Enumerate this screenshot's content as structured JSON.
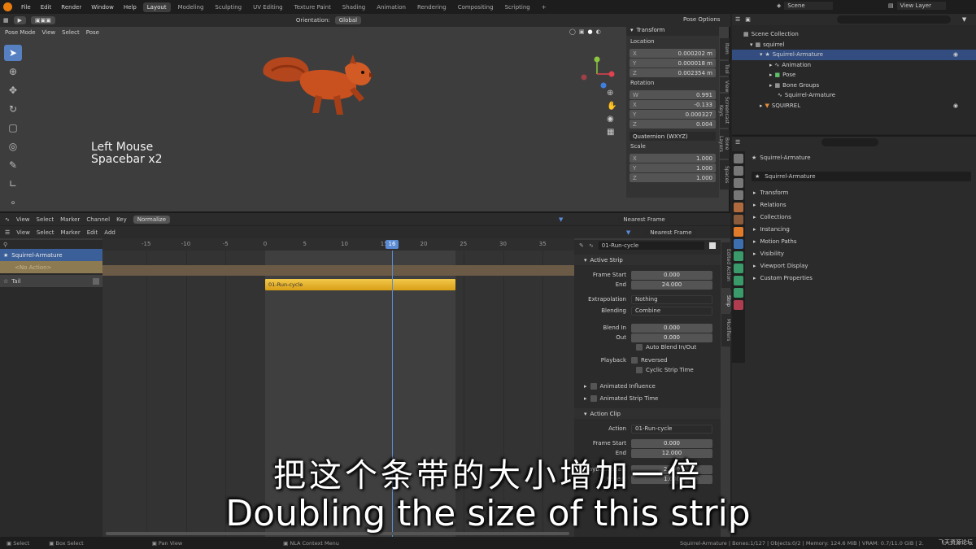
{
  "topbar": {
    "menus": [
      "File",
      "Edit",
      "Render",
      "Window",
      "Help"
    ],
    "workspaces": [
      {
        "label": "Layout",
        "active": true
      },
      {
        "label": "Modeling",
        "active": false
      },
      {
        "label": "Sculpting",
        "active": false
      },
      {
        "label": "UV Editing",
        "active": false
      },
      {
        "label": "Texture Paint",
        "active": false
      },
      {
        "label": "Shading",
        "active": false
      },
      {
        "label": "Animation",
        "active": false
      },
      {
        "label": "Rendering",
        "active": false
      },
      {
        "label": "Compositing",
        "active": false
      },
      {
        "label": "Scripting",
        "active": false
      }
    ],
    "add_workspace": "+",
    "scene": "Scene",
    "view_layer": "View Layer"
  },
  "viewport": {
    "orientation_label": "Orientation:",
    "orientation": "Global",
    "pose_options": "Pose Options",
    "mode": "Pose Mode",
    "menus": [
      "View",
      "Select",
      "Pose"
    ],
    "overlay_line1": "Left Mouse",
    "overlay_line2": "Spacebar x2"
  },
  "npanel": {
    "header": "Transform",
    "location_label": "Location",
    "location": [
      {
        "axis": "X",
        "value": "0.000202 m"
      },
      {
        "axis": "Y",
        "value": "0.000018 m"
      },
      {
        "axis": "Z",
        "value": "0.002354 m"
      }
    ],
    "rotation_label": "Rotation",
    "rotation": [
      {
        "axis": "W",
        "value": "0.991"
      },
      {
        "axis": "X",
        "value": "-0.133"
      },
      {
        "axis": "Y",
        "value": "0.000327"
      },
      {
        "axis": "Z",
        "value": "0.004"
      }
    ],
    "rotation_mode": "Quaternion (WXYZ)",
    "scale_label": "Scale",
    "scale": [
      {
        "axis": "X",
        "value": "1.000"
      },
      {
        "axis": "Y",
        "value": "1.000"
      },
      {
        "axis": "Z",
        "value": "1.000"
      }
    ],
    "tabs": [
      "Item",
      "Tool",
      "View",
      "Screencast Keys",
      "Bone Layers",
      "Spaces"
    ]
  },
  "outliner": {
    "rows": [
      {
        "label": "Scene Collection",
        "indent": 0,
        "selected": false
      },
      {
        "label": "squirrel",
        "indent": 1,
        "selected": false
      },
      {
        "label": "Squirrel-Armature",
        "indent": 2,
        "selected": true
      },
      {
        "label": "Animation",
        "indent": 3,
        "selected": false
      },
      {
        "label": "Pose",
        "indent": 3,
        "selected": false
      },
      {
        "label": "Bone Groups",
        "indent": 3,
        "selected": false
      },
      {
        "label": "Squirrel-Armature",
        "indent": 3,
        "selected": false
      },
      {
        "label": "SQUIRREL",
        "indent": 2,
        "selected": false
      }
    ]
  },
  "properties": {
    "object_name": "Squirrel-Armature",
    "data_name": "Squirrel-Armature",
    "sections": [
      "Transform",
      "Relations",
      "Collections",
      "Instancing",
      "Motion Paths",
      "Visibility",
      "Viewport Display",
      "Custom Properties"
    ]
  },
  "timeline": {
    "menus": [
      "View",
      "Select",
      "Marker",
      "Channel",
      "Key"
    ],
    "mode": "Normalize",
    "snap": "Nearest Frame"
  },
  "nla": {
    "menus": [
      "View",
      "Select",
      "Marker",
      "Edit",
      "Add"
    ],
    "snap": "Nearest Frame",
    "ruler": [
      -15,
      -10,
      -5,
      0,
      5,
      10,
      15,
      20,
      25,
      30,
      35
    ],
    "current_frame": "16",
    "channels": [
      {
        "label": "Squirrel-Armature"
      },
      {
        "label": "<No Action>"
      },
      {
        "label": "Tail"
      }
    ],
    "strip_label": "01-Run-cycle",
    "strip_start": 0,
    "strip_end": 24,
    "current_frame_value": 16,
    "side": {
      "strip_name": "01-Run-cycle",
      "active_strip_header": "Active Strip",
      "frame_start_label": "Frame Start",
      "frame_start": "0.000",
      "end_label": "End",
      "end": "24.000",
      "extrapolation_label": "Extrapolation",
      "extrapolation": "Nothing",
      "blending_label": "Blending",
      "blending": "Combine",
      "blend_in_label": "Blend In",
      "blend_in": "0.000",
      "out_label": "Out",
      "out": "0.000",
      "auto_blend": "Auto Blend In/Out",
      "playback_label": "Playback",
      "reversed": "Reversed",
      "cyclic": "Cyclic Strip Time",
      "animated_influence": "Animated Influence",
      "animated_strip_time": "Animated Strip Time",
      "action_clip_header": "Action Clip",
      "action_label": "Action",
      "action": "01-Run-cycle",
      "ac_frame_start_label": "Frame Start",
      "ac_frame_start": "0.000",
      "ac_end_label": "End",
      "ac_end": "12.000",
      "playback_scale_label": "Playback Scale",
      "playback_scale": "2.000",
      "repeat_label": "Repeat",
      "repeat": "1.000",
      "tabs": [
        "Edited Action",
        "Strip",
        "Modifiers"
      ]
    }
  },
  "status": {
    "items": [
      "Select",
      "Box Select",
      "Pan View",
      "NLA Context Menu"
    ],
    "right": "Squirrel-Armature | Bones:1/127 | Objects:0/2 | Memory: 124.6 MiB | VRAM: 0.7/11.0 GiB | 2.92.0 Alpha"
  },
  "subtitles": {
    "cn": "把这个条带的大小增加一倍",
    "en": "Doubling the size of this strip"
  },
  "watermark": "飞天资源论坛"
}
